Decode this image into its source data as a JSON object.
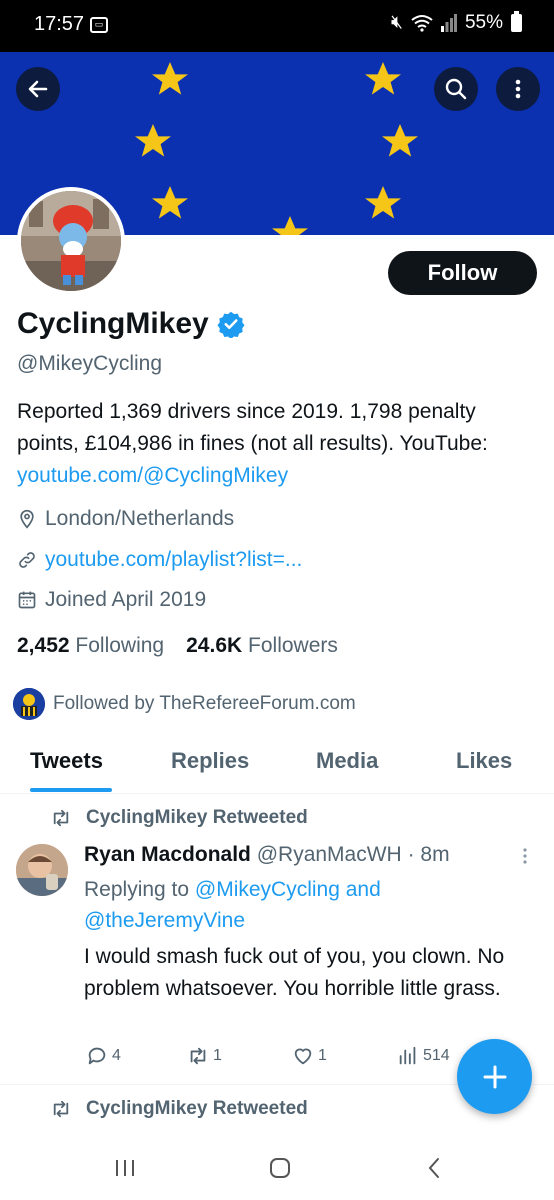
{
  "status": {
    "time": "17:57",
    "battery": "55%"
  },
  "profile": {
    "name": "CyclingMikey",
    "handle": "@MikeyCycling",
    "follow_label": "Follow",
    "bio_text": "Reported 1,369 drivers since 2019. 1,798 penalty points, £104,986 in fines (not all results). YouTube: ",
    "bio_link": "youtube.com/@CyclingMikey",
    "location": "London/Netherlands",
    "website": "youtube.com/playlist?list=...",
    "joined": "Joined April 2019",
    "following_count": "2,452",
    "following_label": "Following",
    "followers_count": "24.6K",
    "followers_label": "Followers",
    "followed_by": "Followed by TheRefereeForum.com"
  },
  "tabs": [
    {
      "label": "Tweets",
      "active": true
    },
    {
      "label": "Replies",
      "active": false
    },
    {
      "label": "Media",
      "active": false
    },
    {
      "label": "Likes",
      "active": false
    }
  ],
  "tweet": {
    "retweet_label": "CyclingMikey Retweeted",
    "author_name": "Ryan Macdonald",
    "author_handle": "@RyanMacWH",
    "time": "· 8m",
    "replying_prefix": "Replying to ",
    "replying_to_1": "@MikeyCycling",
    "replying_and": " and",
    "replying_to_2": "@theJeremyVine",
    "text": "I would smash fuck out of you, you clown. No problem whatsoever. You horrible little grass.",
    "replies": "4",
    "retweets": "1",
    "likes": "1",
    "views": "514"
  },
  "next_tweet": {
    "retweet_label": "CyclingMikey Retweeted"
  },
  "colors": {
    "accent": "#1d9bf0",
    "banner": "#0b30b0",
    "star": "#f5c518",
    "text": "#0f1419",
    "muted": "#536471"
  }
}
